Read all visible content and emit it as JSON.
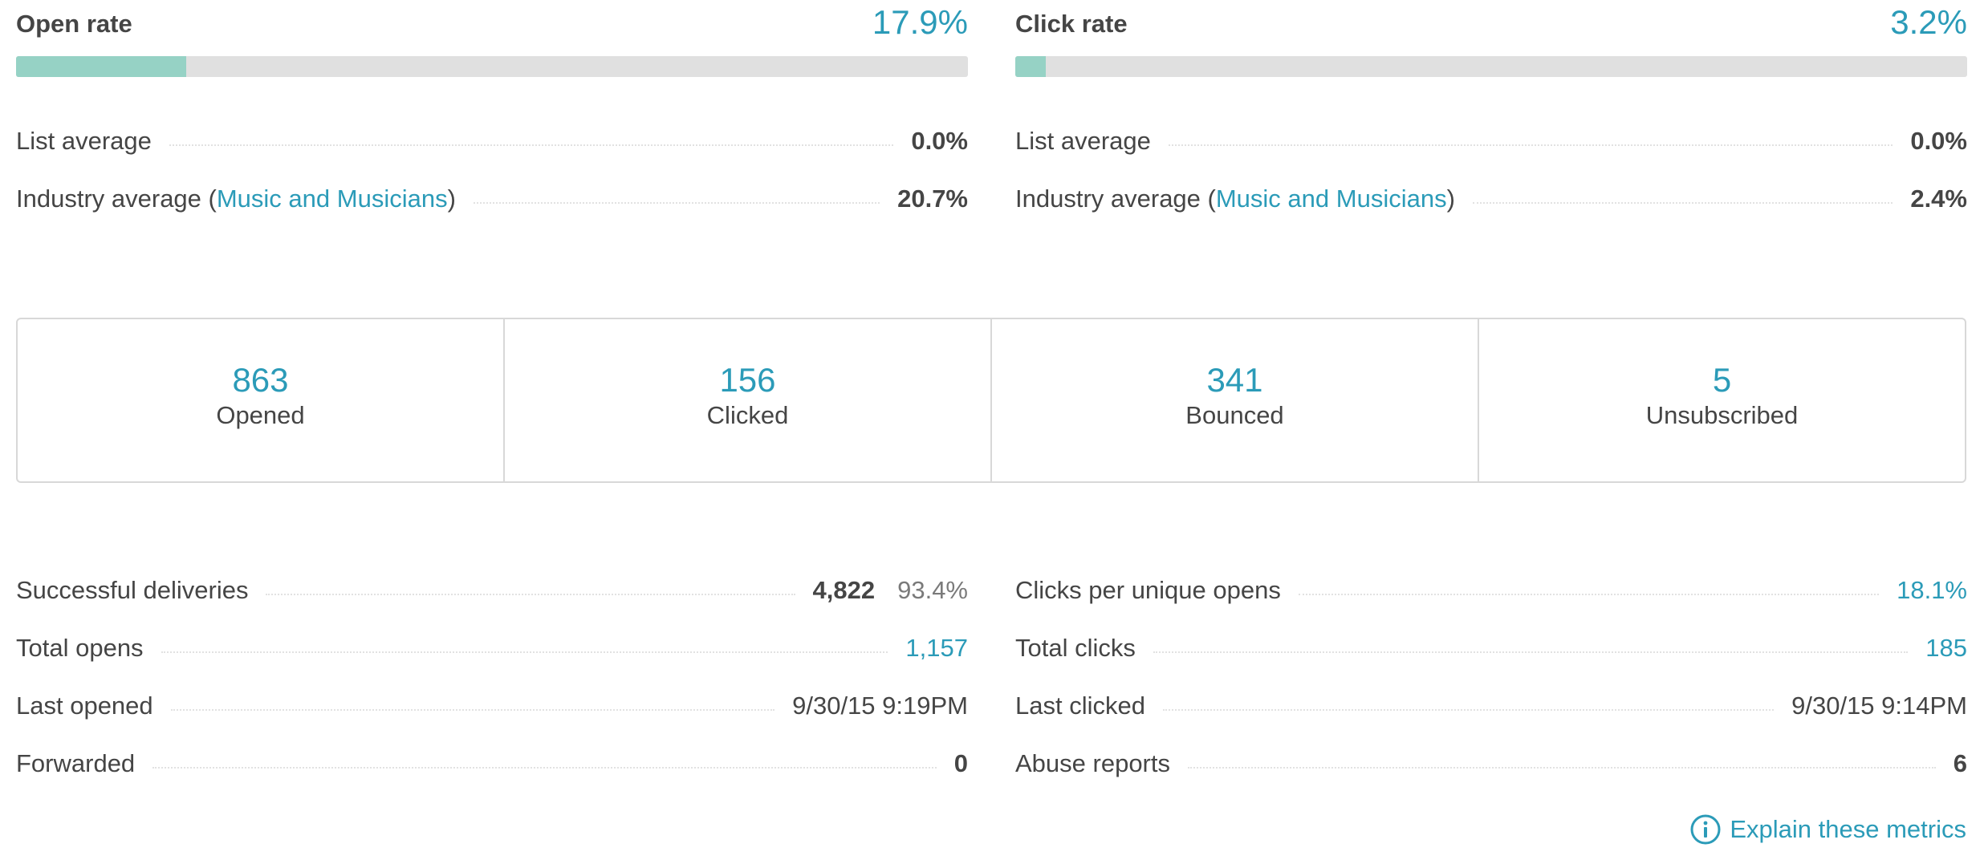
{
  "open_rate": {
    "title": "Open rate",
    "value": "17.9%",
    "fill_fraction": 0.179,
    "list_average_label": "List average",
    "list_average_value": "0.0%",
    "industry_label_prefix": "Industry average (",
    "industry_link": "Music and Musicians",
    "industry_label_suffix": ")",
    "industry_value": "20.7%"
  },
  "click_rate": {
    "title": "Click rate",
    "value": "3.2%",
    "fill_fraction": 0.032,
    "list_average_label": "List average",
    "list_average_value": "0.0%",
    "industry_label_prefix": "Industry average (",
    "industry_link": "Music and Musicians",
    "industry_label_suffix": ")",
    "industry_value": "2.4%"
  },
  "stats": [
    {
      "value": "863",
      "label": "Opened"
    },
    {
      "value": "156",
      "label": "Clicked"
    },
    {
      "value": "341",
      "label": "Bounced"
    },
    {
      "value": "5",
      "label": "Unsubscribed"
    }
  ],
  "details_left": [
    {
      "label": "Successful deliveries",
      "value": "4,822",
      "extra": "93.4%"
    },
    {
      "label": "Total opens",
      "value": "1,157"
    },
    {
      "label": "Last opened",
      "value": "9/30/15 9:19PM"
    },
    {
      "label": "Forwarded",
      "value": "0"
    }
  ],
  "details_right": [
    {
      "label": "Clicks per unique opens",
      "value": "18.1%"
    },
    {
      "label": "Total clicks",
      "value": "185"
    },
    {
      "label": "Last clicked",
      "value": "9/30/15 9:14PM"
    },
    {
      "label": "Abuse reports",
      "value": "6"
    }
  ],
  "explain": {
    "label": "Explain these metrics",
    "icon": "info-circle-icon"
  },
  "colors": {
    "accent": "#2b9bb8",
    "progress_fill": "#96d2c5",
    "progress_track": "#e0e0e0",
    "text": "#454545"
  }
}
